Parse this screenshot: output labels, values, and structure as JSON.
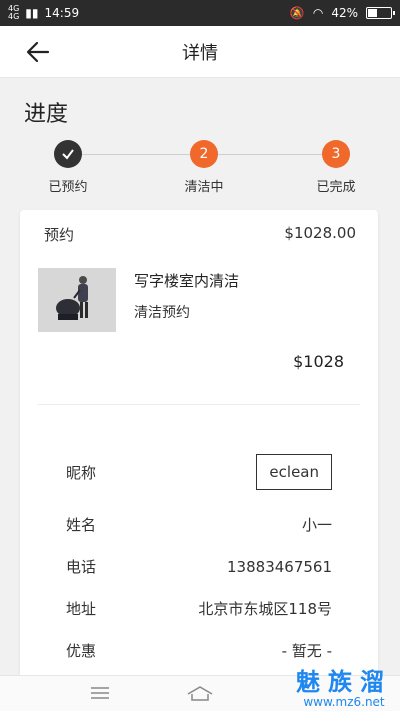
{
  "status_bar": {
    "network_label": "4G",
    "time": "14:59",
    "battery_text": "42%",
    "battery_level": 0.42
  },
  "nav": {
    "title": "详情"
  },
  "progress": {
    "title": "进度",
    "steps": [
      {
        "label": "已预约",
        "number": "",
        "state": "done"
      },
      {
        "label": "清洁中",
        "number": "2",
        "state": "pending"
      },
      {
        "label": "已完成",
        "number": "3",
        "state": "pending"
      }
    ]
  },
  "order": {
    "label": "预约",
    "total": "$1028.00",
    "service_name": "写字楼室内清洁",
    "service_type": "清洁预约",
    "service_price": "$1028"
  },
  "info": {
    "rows": [
      {
        "label": "昵称",
        "value": "eclean"
      },
      {
        "label": "姓名",
        "value": "小一"
      },
      {
        "label": "电话",
        "value": "13883467561"
      },
      {
        "label": "地址",
        "value": "北京市东城区118号"
      },
      {
        "label": "优惠",
        "value": "- 暂无 -"
      }
    ]
  },
  "watermark": {
    "title": "魅族溜",
    "url": "www.mz6.net"
  },
  "colors": {
    "accent": "#f0682a",
    "done": "#333333",
    "watermark": "#1e87f0"
  }
}
